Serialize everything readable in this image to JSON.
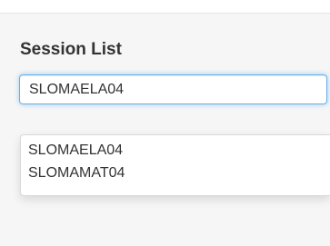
{
  "session_list": {
    "title": "Session List",
    "search": {
      "value": "SLOMAELA04",
      "placeholder": ""
    },
    "suggestions": [
      {
        "label": "SLOMAELA04"
      },
      {
        "label": "SLOMAMAT04"
      }
    ]
  },
  "colors": {
    "panel_background": "#f6f6f6",
    "focus_border": "#66afe9",
    "text": "#333333"
  }
}
